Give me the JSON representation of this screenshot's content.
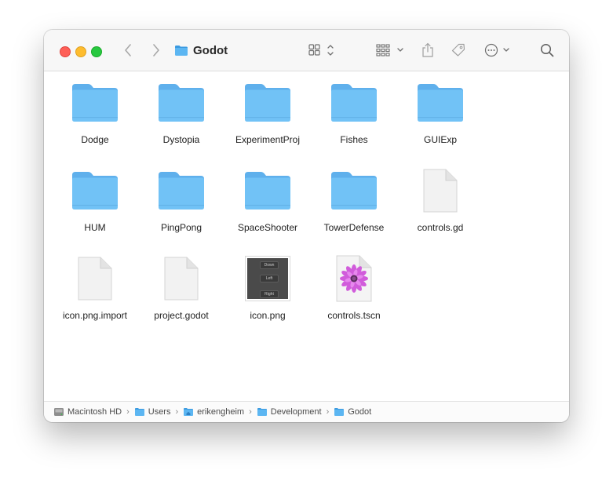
{
  "window": {
    "title": "Godot"
  },
  "toolbar": {
    "icons": [
      "back-chevron-icon",
      "forward-chevron-icon",
      "folder-icon",
      "grid-view-icon",
      "group-by-icon",
      "share-icon",
      "tag-icon",
      "more-icon",
      "search-icon"
    ]
  },
  "items": [
    {
      "name": "Dodge",
      "kind": "folder"
    },
    {
      "name": "Dystopia",
      "kind": "folder"
    },
    {
      "name": "ExperimentProj",
      "kind": "folder"
    },
    {
      "name": "Fishes",
      "kind": "folder"
    },
    {
      "name": "GUIExp",
      "kind": "folder"
    },
    {
      "name": "HUM",
      "kind": "folder"
    },
    {
      "name": "PingPong",
      "kind": "folder"
    },
    {
      "name": "SpaceShooter",
      "kind": "folder"
    },
    {
      "name": "TowerDefense",
      "kind": "folder"
    },
    {
      "name": "controls.gd",
      "kind": "document"
    },
    {
      "name": "icon.png.import",
      "kind": "document"
    },
    {
      "name": "project.godot",
      "kind": "document"
    },
    {
      "name": "icon.png",
      "kind": "image"
    },
    {
      "name": "controls.tscn",
      "kind": "scene"
    }
  ],
  "icon_png_thumbnail": {
    "labels": [
      "Down",
      "Left",
      "Right"
    ]
  },
  "pathbar": {
    "crumbs": [
      "Macintosh HD",
      "Users",
      "erikengheim",
      "Development",
      "Godot"
    ]
  },
  "colors": {
    "folder_top": "#5fb0ec",
    "folder_body": "#71c2f6",
    "traffic_red": "#fe5f57",
    "traffic_yellow": "#febc2e",
    "traffic_green": "#28c840"
  }
}
